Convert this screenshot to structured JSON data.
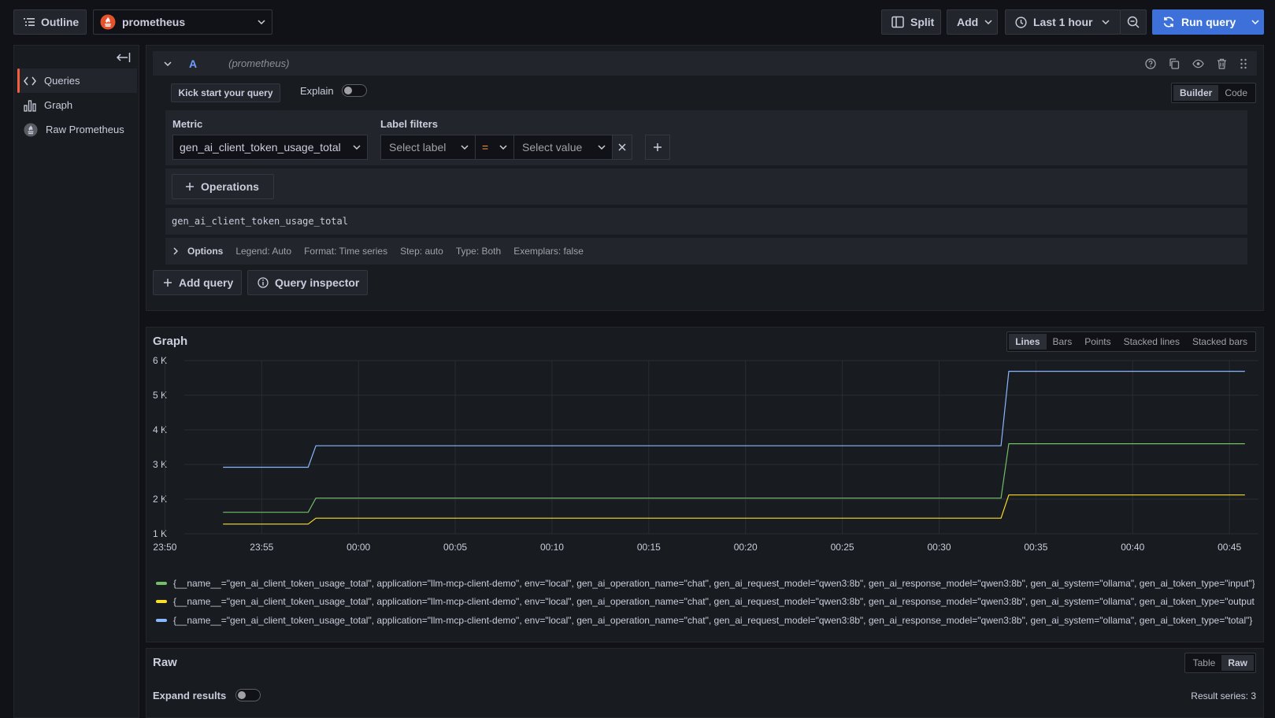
{
  "toolbar": {
    "outline_label": "Outline",
    "datasource": "prometheus",
    "split_label": "Split",
    "add_label": "Add",
    "time_range": "Last 1 hour",
    "run_label": "Run query"
  },
  "sidebar": {
    "items": [
      {
        "label": "Queries",
        "icon": "code-icon",
        "active": true
      },
      {
        "label": "Graph",
        "icon": "bar-chart-icon",
        "active": false
      },
      {
        "label": "Raw Prometheus",
        "icon": "prometheus-icon",
        "active": false
      }
    ]
  },
  "query": {
    "ref_id": "A",
    "datasource_hint": "(prometheus)",
    "kick_start_label": "Kick start your query",
    "explain_label": "Explain",
    "mode_builder": "Builder",
    "mode_code": "Code",
    "metric_label": "Metric",
    "metric_value": "gen_ai_client_token_usage_total",
    "label_filters_label": "Label filters",
    "select_label_placeholder": "Select label",
    "operator": "=",
    "select_value_placeholder": "Select value",
    "operations_label": "Operations",
    "expression": "gen_ai_client_token_usage_total",
    "options": {
      "title": "Options",
      "legend": "Legend: Auto",
      "format": "Format: Time series",
      "step": "Step: auto",
      "type": "Type: Both",
      "exemplars": "Exemplars: false"
    },
    "add_query_label": "Add query",
    "inspector_label": "Query inspector"
  },
  "graph": {
    "title": "Graph",
    "viz_types": [
      "Lines",
      "Bars",
      "Points",
      "Stacked lines",
      "Stacked bars"
    ],
    "viz_selected": "Lines"
  },
  "chart_data": {
    "type": "line",
    "x_ticks": [
      "23:50",
      "23:55",
      "00:00",
      "00:05",
      "00:10",
      "00:15",
      "00:20",
      "00:25",
      "00:30",
      "00:35",
      "00:40",
      "00:45"
    ],
    "y_ticks": [
      "1 K",
      "2 K",
      "3 K",
      "4 K",
      "5 K",
      "6 K"
    ],
    "ylim": [
      1000,
      6000
    ],
    "x_minutes_range": [
      -9.0,
      46.5
    ],
    "grid": true,
    "series": [
      {
        "name": "{__name__=\"gen_ai_client_token_usage_total\", application=\"llm-mcp-client-demo\", env=\"local\", gen_ai_operation_name=\"chat\", gen_ai_request_model=\"qwen3:8b\", gen_ai_response_model=\"qwen3:8b\", gen_ai_system=\"ollama\", gen_ai_token_type=\"input\"}",
        "color": "#73bf69",
        "points": [
          [
            -7.0,
            1620
          ],
          [
            -2.6,
            1620
          ],
          [
            -2.2,
            2030
          ],
          [
            33.2,
            2030
          ],
          [
            33.6,
            3600
          ],
          [
            45.8,
            3600
          ]
        ]
      },
      {
        "name": "{__name__=\"gen_ai_client_token_usage_total\", application=\"llm-mcp-client-demo\", env=\"local\", gen_ai_operation_name=\"chat\", gen_ai_request_model=\"qwen3:8b\", gen_ai_response_model=\"qwen3:8b\", gen_ai_system=\"ollama\", gen_ai_token_type=\"output\"}",
        "color": "#fade2a",
        "points": [
          [
            -7.0,
            1280
          ],
          [
            -2.6,
            1280
          ],
          [
            -2.2,
            1450
          ],
          [
            33.2,
            1450
          ],
          [
            33.6,
            2120
          ],
          [
            45.8,
            2120
          ]
        ]
      },
      {
        "name": "{__name__=\"gen_ai_client_token_usage_total\", application=\"llm-mcp-client-demo\", env=\"local\", gen_ai_operation_name=\"chat\", gen_ai_request_model=\"qwen3:8b\", gen_ai_response_model=\"qwen3:8b\", gen_ai_system=\"ollama\", gen_ai_token_type=\"total\"}",
        "color": "#8ab8ff",
        "points": [
          [
            -7.0,
            2920
          ],
          [
            -2.6,
            2920
          ],
          [
            -2.2,
            3540
          ],
          [
            33.2,
            3540
          ],
          [
            33.6,
            5690
          ],
          [
            45.8,
            5690
          ]
        ]
      }
    ]
  },
  "raw": {
    "title": "Raw",
    "mode_table": "Table",
    "mode_raw": "Raw",
    "expand_label": "Expand results",
    "result_series": "Result series: 3"
  },
  "colors": {
    "accent": "#3d71d9",
    "active_marker": "#f55f3e",
    "ref_letter": "#6e9fff",
    "operator": "#ff9830"
  }
}
